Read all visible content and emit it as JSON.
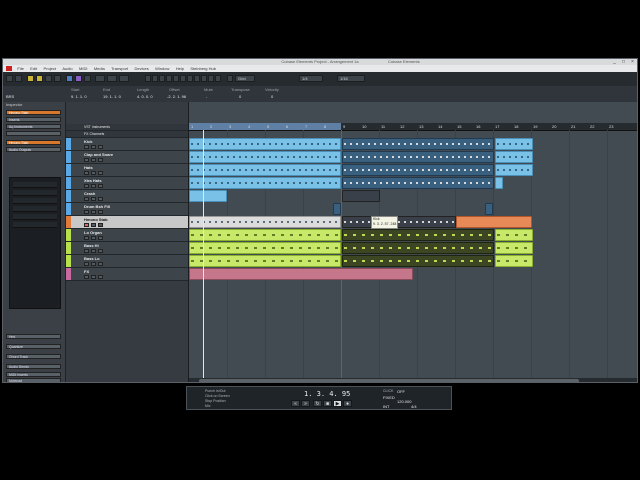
{
  "window": {
    "title": "Cubase Elements Project - Arrangement 1a",
    "title_secondary": "Cubase Elements",
    "controls": [
      "_",
      "□",
      "×"
    ]
  },
  "menu": [
    "File",
    "Edit",
    "Project",
    "Audio",
    "MIDI",
    "Media",
    "Transport",
    "Devices",
    "Window",
    "Help",
    "Steinberg Hub"
  ],
  "infoline": {
    "headers": [
      "Start",
      "End",
      "Length",
      "Offset",
      "Mute",
      "Transpose",
      "Velocity"
    ],
    "values": [
      "9. 1. 1. 0",
      "19. 1. 1. 0",
      "4. 0. 0. 0",
      "-2. 2. 1. 96",
      "-",
      "0",
      "0"
    ],
    "left_label": "BRS"
  },
  "toolbar": {
    "snap_mode": "Grid",
    "quantize": "1/16",
    "zoom": "1/4"
  },
  "inspector": {
    "title": "Inspector",
    "track_name": "Hmono Stab",
    "rows": [
      "Hmono Stab",
      "Inserts",
      "Aq Instruments",
      "",
      "Hmono Stab",
      "Audio Outputs"
    ],
    "bottom_rows": [
      "Hmi",
      "Quantize",
      "Chord Track",
      "Audio Sends",
      "MIDI Inserts",
      "Notepad"
    ]
  },
  "tracks": [
    {
      "name": "VST Instruments",
      "type": "folder"
    },
    {
      "name": "FX Channels",
      "type": "folder"
    },
    {
      "name": "Kick",
      "color": "#5aa9e6"
    },
    {
      "name": "Clap and Snare",
      "color": "#5aa9e6"
    },
    {
      "name": "Hats",
      "color": "#5aa9e6"
    },
    {
      "name": "Xtra Hats",
      "color": "#5aa9e6"
    },
    {
      "name": "Crash",
      "color": "#5aa9e6"
    },
    {
      "name": "Drum Bsh Fill",
      "color": "#5aa9e6"
    },
    {
      "name": "Hmono Stab",
      "color": "#e07a3a",
      "selected": true
    },
    {
      "name": "Lo Organ",
      "color": "#b8e04a"
    },
    {
      "name": "Bass Hi",
      "color": "#b8e04a"
    },
    {
      "name": "Bass Lo",
      "color": "#b8e04a"
    },
    {
      "name": "FX",
      "color": "#c86aa0"
    }
  ],
  "ruler": {
    "bars": [
      "1",
      "2",
      "3",
      "4",
      "5",
      "6",
      "7",
      "8",
      "9",
      "10",
      "11",
      "12",
      "13",
      "14",
      "15",
      "16",
      "17",
      "18",
      "19",
      "20",
      "21",
      "22",
      "23"
    ]
  },
  "tooltip": {
    "line1": "Kick",
    "line2": "9. 3. 2. 57. 248"
  },
  "transport": {
    "time": "1. 3. 4. 95",
    "left_labels": [
      "Punch In/Out",
      "Click on Screen",
      "Stop Position",
      "Mix"
    ],
    "click": "OFF",
    "tempo": "120.000",
    "sig": "4/4",
    "mode": "FIXED",
    "sync": "INT"
  }
}
